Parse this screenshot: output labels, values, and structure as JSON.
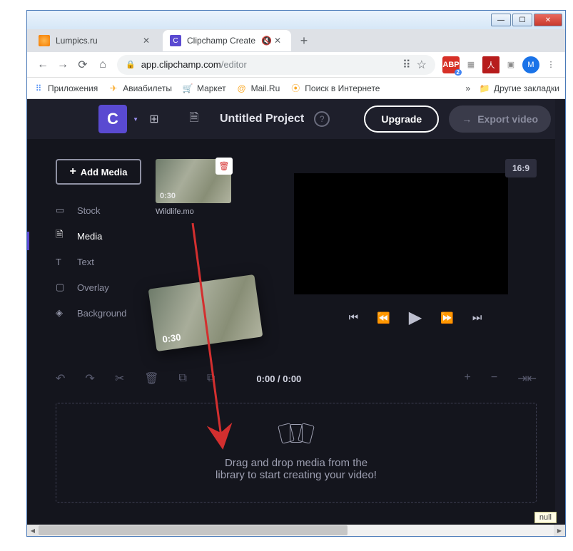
{
  "window": {
    "min": "—",
    "max": "☐",
    "close": "✕"
  },
  "tabs": {
    "t1": {
      "title": "Lumpics.ru"
    },
    "t2": {
      "title": "Clipchamp Create",
      "logo": "C"
    },
    "audio_icon": "🔇",
    "close_icon": "✕",
    "new": "+"
  },
  "addr": {
    "back": "←",
    "fwd": "→",
    "reload": "⟳",
    "home": "⌂",
    "lock": "🔒",
    "host": "app.clipchamp.com",
    "path": "/editor",
    "translate": "⠿",
    "star": "☆",
    "abp": "ABP",
    "abp_badge": "2",
    "ext2": "▦",
    "pdf": "人",
    "m": "M",
    "menu": "⋮"
  },
  "bookmarks": {
    "apps": "Приложения",
    "avia": "Авиабилеты",
    "market": "Маркет",
    "mail": "Mail.Ru",
    "search": "Поиск в Интернете",
    "more": "»",
    "other": "Другие закладки"
  },
  "header": {
    "logo": "C",
    "project_title": "Untitled Project",
    "help": "?",
    "upgrade": "Upgrade",
    "export_arrow": "→",
    "export": "Export video"
  },
  "sidebar": {
    "add_media_plus": "+",
    "add_media": "Add Media",
    "items": [
      {
        "icon": "▭",
        "label": "Stock"
      },
      {
        "icon": "🗎",
        "label": "Media"
      },
      {
        "icon": "T",
        "label": "Text"
      },
      {
        "icon": "▢",
        "label": "Overlay"
      },
      {
        "icon": "◈",
        "label": "Background"
      }
    ]
  },
  "media": {
    "duration": "0:30",
    "filename": "Wildlife.mо",
    "delete_icon": "🗑",
    "drag_duration": "0:30"
  },
  "preview": {
    "ratio": "16:9",
    "ctrl_prev": "⏮",
    "ctrl_rew": "⏪",
    "ctrl_play": "▶",
    "ctrl_ff": "⏩",
    "ctrl_next": "⏭"
  },
  "timeline": {
    "undo": "↶",
    "redo": "↷",
    "cut": "✂",
    "delete": "🗑",
    "copy1": "⧉",
    "copy2": "⧉",
    "time": "0:00 / 0:00",
    "zoom_in": "+",
    "zoom_out": "−",
    "fit": "⇥⇤"
  },
  "dropzone": {
    "line1": "Drag and drop media from the",
    "line2": "library to start creating your video!"
  },
  "null_label": "null"
}
